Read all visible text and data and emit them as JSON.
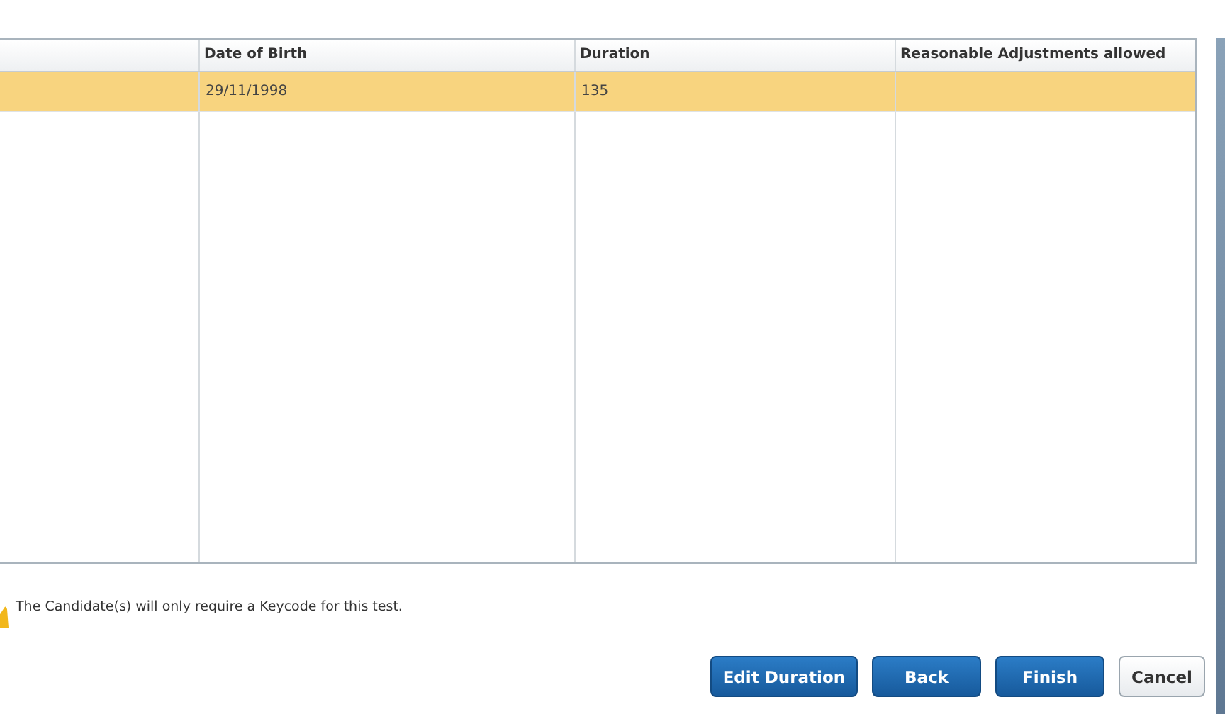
{
  "table": {
    "columns": [
      null,
      {
        "label": "Date of Birth"
      },
      {
        "label": "Duration"
      },
      {
        "label": "Reasonable Adjustments allowed"
      }
    ],
    "rows": [
      {
        "selected": true,
        "cells": [
          null,
          "29/11/1998",
          "135",
          null
        ]
      }
    ]
  },
  "message": "The Candidate(s) will only require a Keycode for this test.",
  "buttons": [
    {
      "label": "Edit Duration",
      "kind": "primary"
    },
    {
      "label": "Back",
      "kind": "primary"
    },
    {
      "label": "Finish",
      "kind": "primary"
    },
    {
      "label": "Cancel",
      "kind": "secondary"
    }
  ]
}
